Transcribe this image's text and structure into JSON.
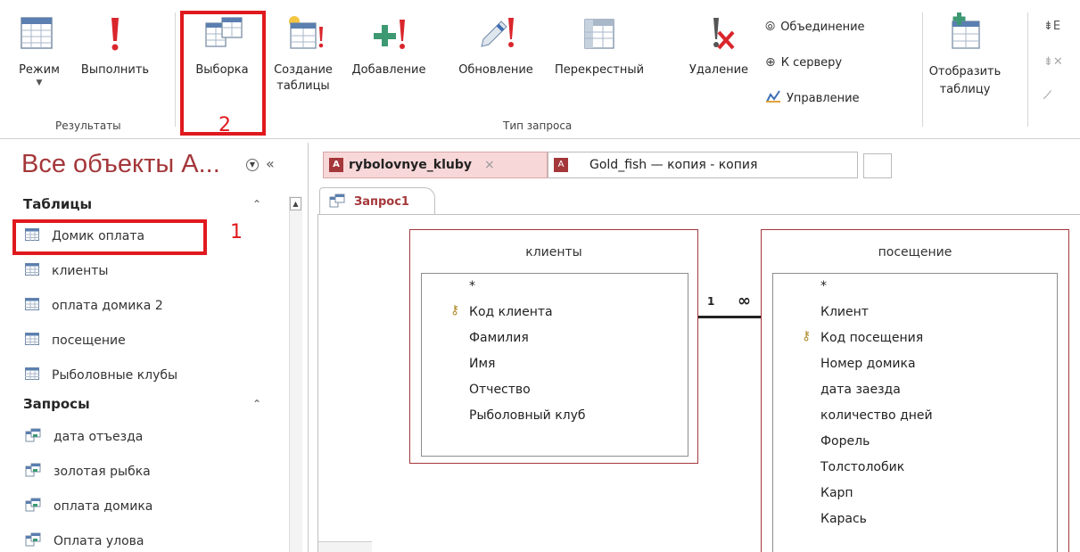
{
  "ribbon": {
    "buttons": {
      "mode": "Режим",
      "run": "Выполнить",
      "select": "Выборка",
      "make_table_1": "Создание",
      "make_table_2": "таблицы",
      "append": "Добавление",
      "update": "Обновление",
      "crosstab": "Перекрестный",
      "delete": "Удаление",
      "union": "Объединение",
      "passthrough": "К серверу",
      "data_definition": "Управление",
      "show_table_1": "Отобразить",
      "show_table_2": "таблицу"
    },
    "groups": {
      "results": "Результаты",
      "query_type": "Тип запроса"
    }
  },
  "annotations": {
    "num1": "1",
    "num2": "2"
  },
  "nav": {
    "title": "Все объекты А...",
    "tables_header": "Таблицы",
    "tables": [
      "Домик оплата",
      "клиенты",
      "оплата домика 2",
      "посещение",
      "Рыболовные клубы"
    ],
    "queries_header": "Запросы",
    "queries": [
      "дата отъезда",
      "золотая рыбка",
      "оплата домика",
      "Оплата улова"
    ]
  },
  "doc": {
    "tabs": [
      "rybolovnye_kluby",
      "Gold_fish — копия - копия"
    ],
    "query_tab": "Запрос1"
  },
  "design": {
    "left_table": {
      "title": "клиенты",
      "fields": [
        "*",
        "Код клиента",
        "Фамилия",
        "Имя",
        "Отчество",
        "Рыболовный клуб"
      ]
    },
    "right_table": {
      "title": "посещение",
      "fields": [
        "*",
        "Клиент",
        "Код посещения",
        "Номер домика",
        "дата заезда",
        "количество дней",
        "Форель",
        "Толстолобик",
        "Карп",
        "Карась"
      ]
    },
    "relation": {
      "one": "1",
      "many": "∞"
    }
  },
  "colors": {
    "accent": "#a4373a",
    "annotation_red": "#e0191e",
    "tab_active": "#f8d7d8"
  }
}
